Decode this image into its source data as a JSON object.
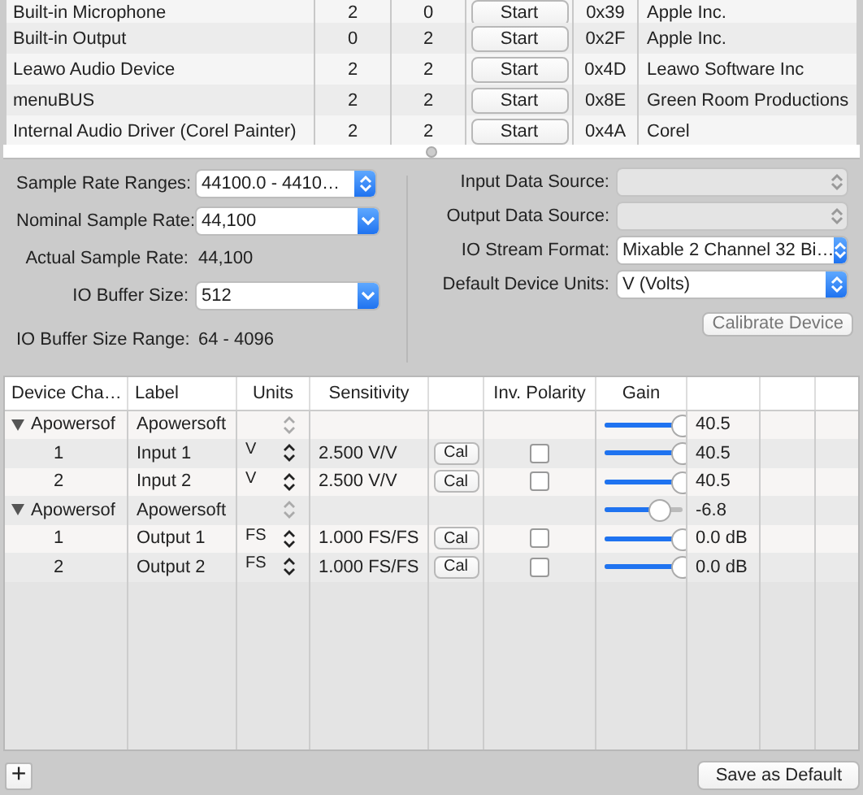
{
  "devices": [
    {
      "name": "Built-in Microphone",
      "inputs": "2",
      "outputs": "0",
      "button": "Start",
      "id": "0x39",
      "vendor": "Apple Inc."
    },
    {
      "name": "Built-in Output",
      "inputs": "0",
      "outputs": "2",
      "button": "Start",
      "id": "0x2F",
      "vendor": "Apple Inc."
    },
    {
      "name": "Leawo Audio Device",
      "inputs": "2",
      "outputs": "2",
      "button": "Start",
      "id": "0x4D",
      "vendor": "Leawo Software Inc"
    },
    {
      "name": "menuBUS",
      "inputs": "2",
      "outputs": "2",
      "button": "Start",
      "id": "0x8E",
      "vendor": "Green Room Productions"
    },
    {
      "name": "Internal Audio Driver (Corel Painter)",
      "inputs": "2",
      "outputs": "2",
      "button": "Start",
      "id": "0x4A",
      "vendor": "Corel"
    }
  ],
  "settings_left": [
    {
      "kind": "stepper",
      "label": "Sample Rate Ranges:",
      "value": "44100.0 - 4410…"
    },
    {
      "kind": "dropdown",
      "label": "Nominal Sample Rate:",
      "value": "44,100"
    },
    {
      "kind": "text",
      "label": "Actual Sample Rate:",
      "value": "44,100"
    },
    {
      "kind": "dropdown",
      "label": "IO Buffer Size:",
      "value": "512"
    },
    {
      "kind": "text",
      "label": "IO Buffer Size Range:",
      "value": "64 - 4096"
    }
  ],
  "settings_right": [
    {
      "label": "Input Data Source:",
      "disabled": true
    },
    {
      "label": "Output Data Source:",
      "disabled": true
    },
    {
      "label": "IO Stream Format:",
      "value": "Mixable 2 Channel 32 Bi…",
      "disabled": false
    },
    {
      "label": "Default Device Units:",
      "value": "V (Volts)",
      "disabled": false
    }
  ],
  "calibrate_button": "Calibrate Device",
  "channels": {
    "columns": [
      "Device Cha…",
      "Label",
      "Units",
      "Sensitivity",
      "Inv. Polarity",
      "Gain"
    ],
    "rows": [
      {
        "kind": "group",
        "channel": "Apowersof",
        "label": "Apowersoft",
        "level": 1.0,
        "gain": "40.5"
      },
      {
        "kind": "channel",
        "channel": "1",
        "label": "Input 1",
        "units": "V",
        "sensitivity": "2.500 V/V",
        "cal": "Cal",
        "inverted": false,
        "level": 1.0,
        "gain": "40.5"
      },
      {
        "kind": "channel",
        "channel": "2",
        "label": "Input 2",
        "units": "V",
        "sensitivity": "2.500 V/V",
        "cal": "Cal",
        "inverted": false,
        "level": 1.0,
        "gain": "40.5"
      },
      {
        "kind": "group",
        "channel": "Apowersof",
        "label": "Apowersoft",
        "level": 0.7,
        "gain": "-6.8"
      },
      {
        "kind": "channel",
        "channel": "1",
        "label": "Output 1",
        "units": "FS",
        "sensitivity": "1.000 FS/FS",
        "cal": "Cal",
        "inverted": false,
        "level": 1.0,
        "gain": "0.0 dB"
      },
      {
        "kind": "channel",
        "channel": "2",
        "label": "Output 2",
        "units": "FS",
        "sensitivity": "1.000 FS/FS",
        "cal": "Cal",
        "inverted": false,
        "level": 1.0,
        "gain": "0.0 dB"
      }
    ]
  },
  "add_button": "+",
  "save_button": "Save as Default"
}
